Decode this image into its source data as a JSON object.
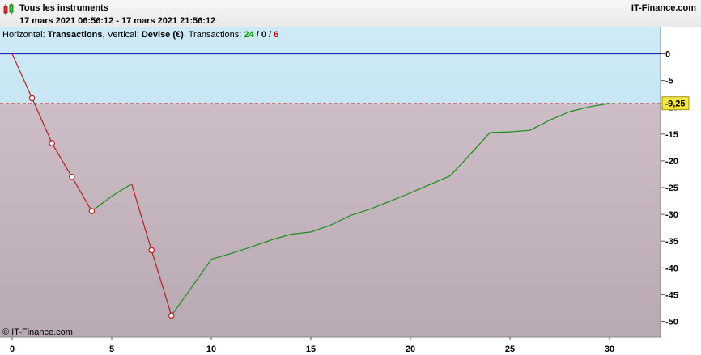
{
  "header": {
    "title": "Tous les instruments",
    "subtitle": "17 mars 2021 06:56:12 - 17 mars 2021 21:56:12",
    "brand": "IT-Finance.com"
  },
  "info": {
    "horizontal_label": "Horizontal:",
    "horizontal_value": "Transactions",
    "vertical_label": "Vertical:",
    "vertical_value": "Devise (€)",
    "transactions_label": "Transactions:",
    "count_total": "24",
    "count_zero": "0",
    "count_losses": "6"
  },
  "copyright": "© IT-Finance.com",
  "colors": {
    "profit_zone": "#c8e6f3",
    "loss_zone": "#b8a9b2",
    "zero_line": "#1f2fb5",
    "threshold_line": "#d05050",
    "down_segment": "#b22222",
    "up_segment": "#1a8f1a",
    "badge": "#f5e642"
  },
  "chart_data": {
    "type": "line",
    "title": "",
    "xlabel": "",
    "ylabel": "",
    "xlim": [
      0,
      32.5
    ],
    "ylim": [
      -53.5,
      4.5
    ],
    "x_ticks": [
      0,
      5,
      10,
      15,
      20,
      25,
      30
    ],
    "y_ticks": [
      0,
      -5,
      -10,
      -15,
      -20,
      -25,
      -30,
      -35,
      -40,
      -45,
      -50
    ],
    "x_tick_labels": [
      "0",
      "5",
      "10",
      "15",
      "20",
      "25",
      "30"
    ],
    "y_tick_labels": [
      "0",
      "-5",
      "-10",
      "-15",
      "-20",
      "-25",
      "-30",
      "-35",
      "-40",
      "-45",
      "-50"
    ],
    "threshold": -9.25,
    "threshold_label": "-9,25",
    "series": [
      {
        "x": [
          0,
          1,
          2,
          3,
          4,
          5,
          6,
          7,
          8,
          9,
          10,
          11,
          12,
          13,
          14,
          15,
          16,
          17,
          18,
          19,
          20,
          21,
          22,
          23,
          24,
          25,
          26,
          27,
          28,
          29,
          30
        ],
        "values": [
          0,
          -8.3,
          -16.7,
          -23.0,
          -29.4,
          -26.6,
          -24.3,
          -36.7,
          -48.9,
          -43.7,
          -38.4,
          -37.3,
          -36.1,
          -34.8,
          -33.7,
          -33.3,
          -32.0,
          -30.2,
          -29.0,
          -27.5,
          -26.0,
          -24.4,
          -22.8,
          -18.8,
          -14.7,
          -14.6,
          -14.3,
          -12.4,
          -10.8,
          -9.9,
          -9.25
        ],
        "markers": [
          1,
          2,
          3,
          4,
          7,
          8
        ]
      }
    ]
  }
}
